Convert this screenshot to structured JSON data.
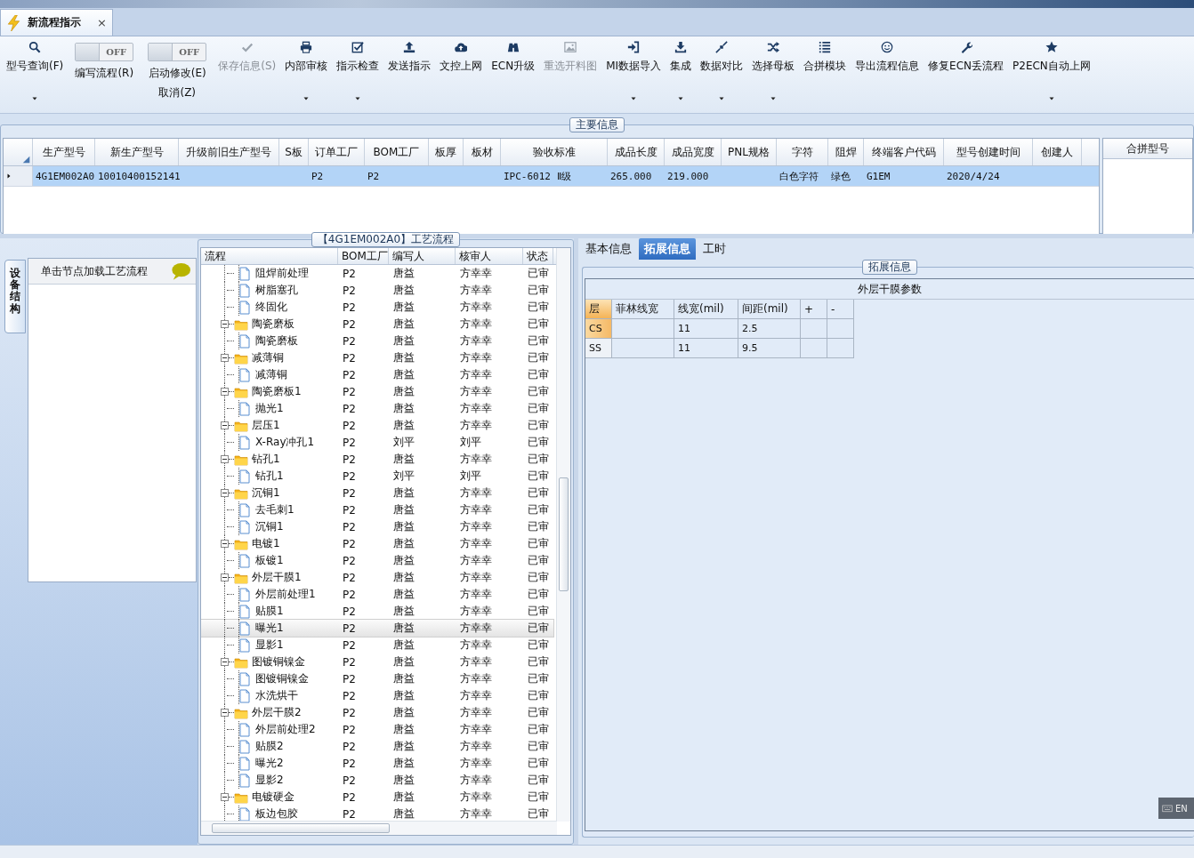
{
  "tab": {
    "title": "新流程指示",
    "close": "×"
  },
  "toolbar": [
    {
      "kind": "button",
      "label": "型号查询(F)",
      "dropdown": true,
      "disabled": false
    },
    {
      "kind": "toggle",
      "label": "编写流程(R)",
      "switch_text": "OFF",
      "on": false
    },
    {
      "kind": "toggle",
      "label": "启动修改(E)",
      "sublabel": "取消(Z)",
      "switch_text": "OFF",
      "on": false
    },
    {
      "kind": "button",
      "label": "保存信息(S)",
      "dropdown": false,
      "disabled": true
    },
    {
      "kind": "button",
      "label": "内部审核",
      "dropdown": true,
      "disabled": false
    },
    {
      "kind": "button",
      "label": "指示检查",
      "dropdown": true,
      "disabled": false
    },
    {
      "kind": "button",
      "label": "发送指示",
      "dropdown": false,
      "disabled": false
    },
    {
      "kind": "button",
      "label": "文控上网",
      "dropdown": false,
      "disabled": false
    },
    {
      "kind": "button",
      "label": "ECN升级",
      "dropdown": false,
      "disabled": false
    },
    {
      "kind": "button",
      "label": "重选开料图",
      "dropdown": false,
      "disabled": true
    },
    {
      "kind": "button",
      "label": "MI数据导入",
      "dropdown": true,
      "disabled": false
    },
    {
      "kind": "button",
      "label": "集成",
      "dropdown": true,
      "disabled": false
    },
    {
      "kind": "button",
      "label": "数据对比",
      "dropdown": true,
      "disabled": false
    },
    {
      "kind": "button",
      "label": "选择母板",
      "dropdown": true,
      "disabled": false
    },
    {
      "kind": "button",
      "label": "合拼模块",
      "dropdown": false,
      "disabled": false
    },
    {
      "kind": "button",
      "label": "导出流程信息",
      "dropdown": false,
      "disabled": false
    },
    {
      "kind": "button",
      "label": "修复ECN丢流程",
      "dropdown": false,
      "disabled": false
    },
    {
      "kind": "button",
      "label": "P2ECN自动上网",
      "dropdown": true,
      "disabled": false
    }
  ],
  "main_info": {
    "legend": "主要信息",
    "table": {
      "columns": [
        "生产型号",
        "新生产型号",
        "升级前旧生产型号",
        "S板",
        "订单工厂",
        "BOM工厂",
        "板厚",
        "板材",
        "验收标准",
        "成品长度",
        "成品宽度",
        "PNL规格",
        "字符",
        "阻焊",
        "终端客户代码",
        "型号创建时间",
        "创建人"
      ],
      "rows": [
        {
          "selected": true,
          "cells": [
            "4G1EM002A0",
            "10010400152141",
            null,
            null,
            "P2",
            "P2",
            null,
            null,
            "IPC-6012 Ⅱ级",
            "265.000",
            "219.000",
            null,
            "白色字符",
            "绿色",
            "G1EM",
            "2020/4/24",
            null
          ]
        }
      ]
    },
    "side_table": {
      "columns": [
        "合拼型号"
      ]
    }
  },
  "left_panel": {
    "side_tab": {
      "label": "设备结构",
      "selected": true
    },
    "header": "单击节点加载工艺流程"
  },
  "process": {
    "legend": "【4G1EM002A0】工艺流程",
    "columns": [
      "流程",
      "BOM工厂",
      "编写人",
      "核审人",
      "状态"
    ],
    "nodes": [
      {
        "children": [
          {
            "kind": "file",
            "label": "阻焊前处理",
            "cells": [
              "P2",
              "唐益",
              "方幸幸",
              "已审"
            ],
            "selected": false
          },
          {
            "kind": "file",
            "label": "树脂塞孔",
            "cells": [
              "P2",
              "唐益",
              "方幸幸",
              "已审"
            ],
            "selected": false
          },
          {
            "kind": "file",
            "label": "终固化",
            "cells": [
              "P2",
              "唐益",
              "方幸幸",
              "已审"
            ],
            "selected": false
          }
        ]
      },
      {
        "kind": "folder",
        "label": "陶瓷磨板",
        "cells": [
          "P2",
          "唐益",
          "方幸幸",
          "已审"
        ],
        "selected": false,
        "expanded": true,
        "children": [
          {
            "kind": "file",
            "label": "陶瓷磨板",
            "cells": [
              "P2",
              "唐益",
              "方幸幸",
              "已审"
            ],
            "selected": false
          }
        ]
      },
      {
        "kind": "folder",
        "label": "减薄铜",
        "cells": [
          "P2",
          "唐益",
          "方幸幸",
          "已审"
        ],
        "selected": false,
        "expanded": true,
        "children": [
          {
            "kind": "file",
            "label": "减薄铜",
            "cells": [
              "P2",
              "唐益",
              "方幸幸",
              "已审"
            ],
            "selected": false
          }
        ]
      },
      {
        "kind": "folder",
        "label": "陶瓷磨板1",
        "cells": [
          "P2",
          "唐益",
          "方幸幸",
          "已审"
        ],
        "selected": false,
        "expanded": true,
        "children": [
          {
            "kind": "file",
            "label": "抛光1",
            "cells": [
              "P2",
              "唐益",
              "方幸幸",
              "已审"
            ],
            "selected": false
          }
        ]
      },
      {
        "kind": "folder",
        "label": "层压1",
        "cells": [
          "P2",
          "唐益",
          "方幸幸",
          "已审"
        ],
        "selected": false,
        "expanded": true,
        "children": [
          {
            "kind": "file",
            "label": "X-Ray冲孔1",
            "cells": [
              "P2",
              "刘平",
              "刘平",
              "已审"
            ],
            "selected": false
          }
        ]
      },
      {
        "kind": "folder",
        "label": "钻孔1",
        "cells": [
          "P2",
          "唐益",
          "方幸幸",
          "已审"
        ],
        "selected": false,
        "expanded": true,
        "children": [
          {
            "kind": "file",
            "label": "钻孔1",
            "cells": [
              "P2",
              "刘平",
              "刘平",
              "已审"
            ],
            "selected": false
          }
        ]
      },
      {
        "kind": "folder",
        "label": "沉铜1",
        "cells": [
          "P2",
          "唐益",
          "方幸幸",
          "已审"
        ],
        "selected": false,
        "expanded": true,
        "children": [
          {
            "kind": "file",
            "label": "去毛刺1",
            "cells": [
              "P2",
              "唐益",
              "方幸幸",
              "已审"
            ],
            "selected": false
          },
          {
            "kind": "file",
            "label": "沉铜1",
            "cells": [
              "P2",
              "唐益",
              "方幸幸",
              "已审"
            ],
            "selected": false
          }
        ]
      },
      {
        "kind": "folder",
        "label": "电镀1",
        "cells": [
          "P2",
          "唐益",
          "方幸幸",
          "已审"
        ],
        "selected": false,
        "expanded": true,
        "children": [
          {
            "kind": "file",
            "label": "板镀1",
            "cells": [
              "P2",
              "唐益",
              "方幸幸",
              "已审"
            ],
            "selected": false
          }
        ]
      },
      {
        "kind": "folder",
        "label": "外层干膜1",
        "cells": [
          "P2",
          "唐益",
          "方幸幸",
          "已审"
        ],
        "selected": false,
        "expanded": true,
        "children": [
          {
            "kind": "file",
            "label": "外层前处理1",
            "cells": [
              "P2",
              "唐益",
              "方幸幸",
              "已审"
            ],
            "selected": false
          },
          {
            "kind": "file",
            "label": "贴膜1",
            "cells": [
              "P2",
              "唐益",
              "方幸幸",
              "已审"
            ],
            "selected": false
          },
          {
            "kind": "file",
            "label": "曝光1",
            "cells": [
              "P2",
              "唐益",
              "方幸幸",
              "已审"
            ],
            "selected": true
          },
          {
            "kind": "file",
            "label": "显影1",
            "cells": [
              "P2",
              "唐益",
              "方幸幸",
              "已审"
            ],
            "selected": false
          }
        ]
      },
      {
        "kind": "folder",
        "label": "图镀铜镍金",
        "cells": [
          "P2",
          "唐益",
          "方幸幸",
          "已审"
        ],
        "selected": false,
        "expanded": true,
        "children": [
          {
            "kind": "file",
            "label": "图镀铜镍金",
            "cells": [
              "P2",
              "唐益",
              "方幸幸",
              "已审"
            ],
            "selected": false
          },
          {
            "kind": "file",
            "label": "水洗烘干",
            "cells": [
              "P2",
              "唐益",
              "方幸幸",
              "已审"
            ],
            "selected": false
          }
        ]
      },
      {
        "kind": "folder",
        "label": "外层干膜2",
        "cells": [
          "P2",
          "唐益",
          "方幸幸",
          "已审"
        ],
        "selected": false,
        "expanded": true,
        "children": [
          {
            "kind": "file",
            "label": "外层前处理2",
            "cells": [
              "P2",
              "唐益",
              "方幸幸",
              "已审"
            ],
            "selected": false
          },
          {
            "kind": "file",
            "label": "贴膜2",
            "cells": [
              "P2",
              "唐益",
              "方幸幸",
              "已审"
            ],
            "selected": false
          },
          {
            "kind": "file",
            "label": "曝光2",
            "cells": [
              "P2",
              "唐益",
              "方幸幸",
              "已审"
            ],
            "selected": false
          },
          {
            "kind": "file",
            "label": "显影2",
            "cells": [
              "P2",
              "唐益",
              "方幸幸",
              "已审"
            ],
            "selected": false
          }
        ]
      },
      {
        "kind": "folder",
        "label": "电镀硬金",
        "cells": [
          "P2",
          "唐益",
          "方幸幸",
          "已审"
        ],
        "selected": false,
        "expanded": true,
        "children": [
          {
            "kind": "file",
            "label": "板边包胶",
            "cells": [
              "P2",
              "唐益",
              "方幸幸",
              "已审"
            ],
            "selected": false
          }
        ]
      }
    ]
  },
  "details": {
    "tabs": [
      {
        "label": "基本信息",
        "selected": false
      },
      {
        "label": "拓展信息",
        "selected": true
      },
      {
        "label": "工时",
        "selected": false
      }
    ],
    "legend": "拓展信息",
    "grid": {
      "title": "外层干膜参数",
      "columns": [
        "层",
        "菲林线宽",
        "线宽(mil)",
        "间距(mil)",
        "+",
        "-"
      ],
      "rows": [
        {
          "selected": true,
          "cells": [
            "CS",
            null,
            "11",
            "2.5",
            null,
            null
          ]
        },
        {
          "selected": false,
          "cells": [
            "SS",
            null,
            "11",
            "9.5",
            null,
            null
          ]
        }
      ]
    }
  },
  "ime": {
    "label": "EN"
  }
}
